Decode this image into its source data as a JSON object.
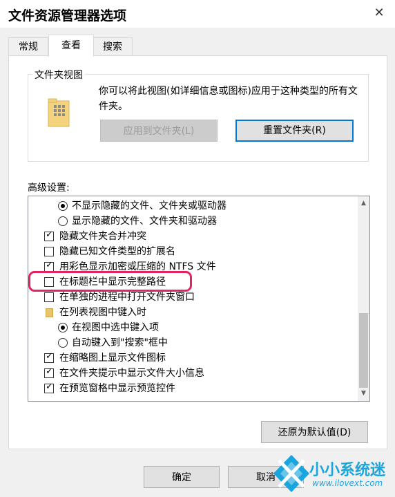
{
  "window": {
    "title": "文件资源管理器选项"
  },
  "tabs": [
    {
      "label": "常规"
    },
    {
      "label": "查看"
    },
    {
      "label": "搜索"
    }
  ],
  "folder_views": {
    "group_title": "文件夹视图",
    "description": "你可以将此视图(如详细信息或图标)应用于这种类型的所有文件夹。",
    "apply_button": "应用到文件夹(L)",
    "reset_button": "重置文件夹(R)"
  },
  "advanced": {
    "label": "高级设置:",
    "items": [
      {
        "type": "radio",
        "checked": true,
        "label": "不显示隐藏的文件、文件夹或驱动器"
      },
      {
        "type": "radio",
        "checked": false,
        "label": "显示隐藏的文件、文件夹和驱动器"
      },
      {
        "type": "checkbox",
        "checked": true,
        "label": "隐藏文件夹合并冲突"
      },
      {
        "type": "checkbox",
        "checked": false,
        "label": "隐藏已知文件类型的扩展名"
      },
      {
        "type": "checkbox",
        "checked": true,
        "label": "用彩色显示加密或压缩的 NTFS 文件"
      },
      {
        "type": "checkbox",
        "checked": false,
        "label": "在标题栏中显示完整路径"
      },
      {
        "type": "checkbox",
        "checked": false,
        "label": "在单独的进程中打开文件夹窗口"
      },
      {
        "type": "folder",
        "label": "在列表视图中键入时"
      },
      {
        "type": "radio",
        "checked": true,
        "label": "在视图中选中键入项"
      },
      {
        "type": "radio",
        "checked": false,
        "label": "自动键入到\"搜索\"框中"
      },
      {
        "type": "checkbox",
        "checked": true,
        "label": "在缩略图上显示文件图标"
      },
      {
        "type": "checkbox",
        "checked": true,
        "label": "在文件夹提示中显示文件大小信息"
      },
      {
        "type": "checkbox",
        "checked": true,
        "label": "在预览窗格中显示预览控件"
      }
    ]
  },
  "restore_button": "还原为默认值(D)",
  "footer": {
    "ok_button": "确定",
    "cancel_button": "取消"
  },
  "watermark": {
    "brand": "小小系统迷",
    "url": "www.ilovext.com"
  },
  "colors": {
    "accent": "#0078d7",
    "highlight": "#e0245e",
    "watermark": "#1aa5de"
  }
}
